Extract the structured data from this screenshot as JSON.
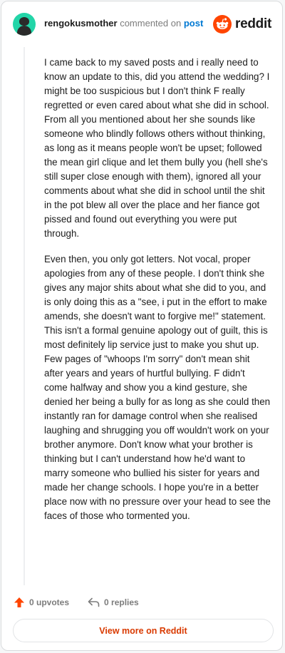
{
  "header": {
    "username": "rengokusmother",
    "action_text": "commented on",
    "link_text": "post",
    "brand": "reddit",
    "brand_color": "#ff4500"
  },
  "comment": {
    "paragraphs": [
      "I came back to my saved posts and i really need to know an update to this, did you attend the wedding? I might be too suspicious but I don't think F really regretted or even cared about what she did in school. From all you mentioned about her she sounds like someone who blindly follows others without thinking, as long as it means people won't be upset; followed the mean girl clique and let them bully you (hell she's still super close enough with them), ignored all your comments about what she did in school until the shit in the pot blew all over the place and her fiance got pissed and found out everything you were put through.",
      "Even then, you only got letters. Not vocal, proper apologies from any of these people. I don't think she gives any major shits about what she did to you, and is only doing this as a \"see, i put in the effort to make amends, she doesn't want to forgive me!\" statement. This isn't a formal genuine apology out of guilt, this is most definitely lip service just to make you shut up. Few pages of \"whoops I'm sorry\" don't mean shit after years and years of hurtful bullying. F didn't come halfway and show you a kind gesture, she denied her being a bully for as long as she could then instantly ran for damage control when she realised laughing and shrugging you off wouldn't work on your brother anymore. Don't know what your brother is thinking but I can't understand how he'd want to marry someone who bullied his sister for years and made her change schools. I hope you're in a better place now with no pressure over your head to see the faces of those who tormented you."
    ]
  },
  "actions": {
    "upvotes": "0 upvotes",
    "replies": "0 replies"
  },
  "footer": {
    "view_more": "View more on Reddit"
  },
  "icons": {
    "avatar": "snoo-avatar-icon",
    "logo": "reddit-logo-icon",
    "upvote": "upvote-arrow-icon",
    "reply": "reply-arrow-icon"
  }
}
